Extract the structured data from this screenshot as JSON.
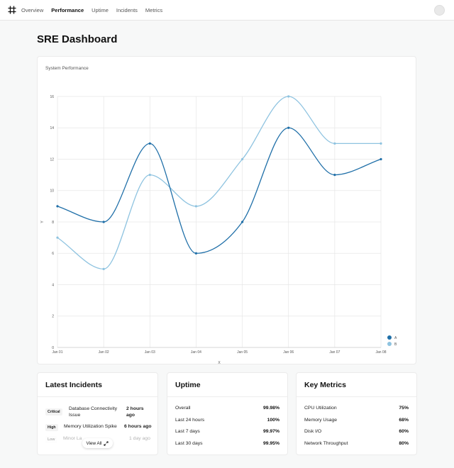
{
  "nav": {
    "items": [
      "Overview",
      "Performance",
      "Uptime",
      "Incidents",
      "Metrics"
    ],
    "active": "Performance"
  },
  "page": {
    "title": "SRE Dashboard"
  },
  "chart_card": {
    "title": "System Performance"
  },
  "chart_data": {
    "type": "line",
    "x": [
      "Jan 01",
      "Jan 02",
      "Jan 03",
      "Jan 04",
      "Jan 05",
      "Jan 06",
      "Jan 07",
      "Jan 08"
    ],
    "series": [
      {
        "name": "A",
        "values": [
          9,
          8,
          13,
          6,
          8,
          14,
          11,
          12
        ],
        "color": "#1f6fa8"
      },
      {
        "name": "B",
        "values": [
          7,
          5,
          11,
          9,
          12,
          16,
          13,
          13
        ],
        "color": "#8ec3e0"
      }
    ],
    "xlabel": "X",
    "ylabel": "Y",
    "ylim": [
      0,
      16
    ],
    "yticks": [
      0,
      2,
      4,
      6,
      8,
      10,
      12,
      14,
      16
    ],
    "grid": true,
    "legend": "bottom-right"
  },
  "incidents": {
    "title": "Latest Incidents",
    "items": [
      {
        "severity": "Critical",
        "title": "Database Connectivity Issue",
        "time": "2 hours ago"
      },
      {
        "severity": "High",
        "title": "Memory Utilization Spike",
        "time": "6 hours ago"
      },
      {
        "severity": "Low",
        "title": "Minor La",
        "time": "1 day ago"
      }
    ],
    "view_all": "View All"
  },
  "uptime": {
    "title": "Uptime",
    "rows": [
      {
        "label": "Overall",
        "value": "99.98%"
      },
      {
        "label": "Last 24 hours",
        "value": "100%"
      },
      {
        "label": "Last 7 days",
        "value": "99.97%"
      },
      {
        "label": "Last 30 days",
        "value": "99.95%"
      }
    ]
  },
  "metrics": {
    "title": "Key Metrics",
    "rows": [
      {
        "label": "CPU Utilization",
        "value": "75%"
      },
      {
        "label": "Memory Usage",
        "value": "68%"
      },
      {
        "label": "Disk I/O",
        "value": "60%"
      },
      {
        "label": "Network Throughput",
        "value": "80%"
      }
    ]
  }
}
